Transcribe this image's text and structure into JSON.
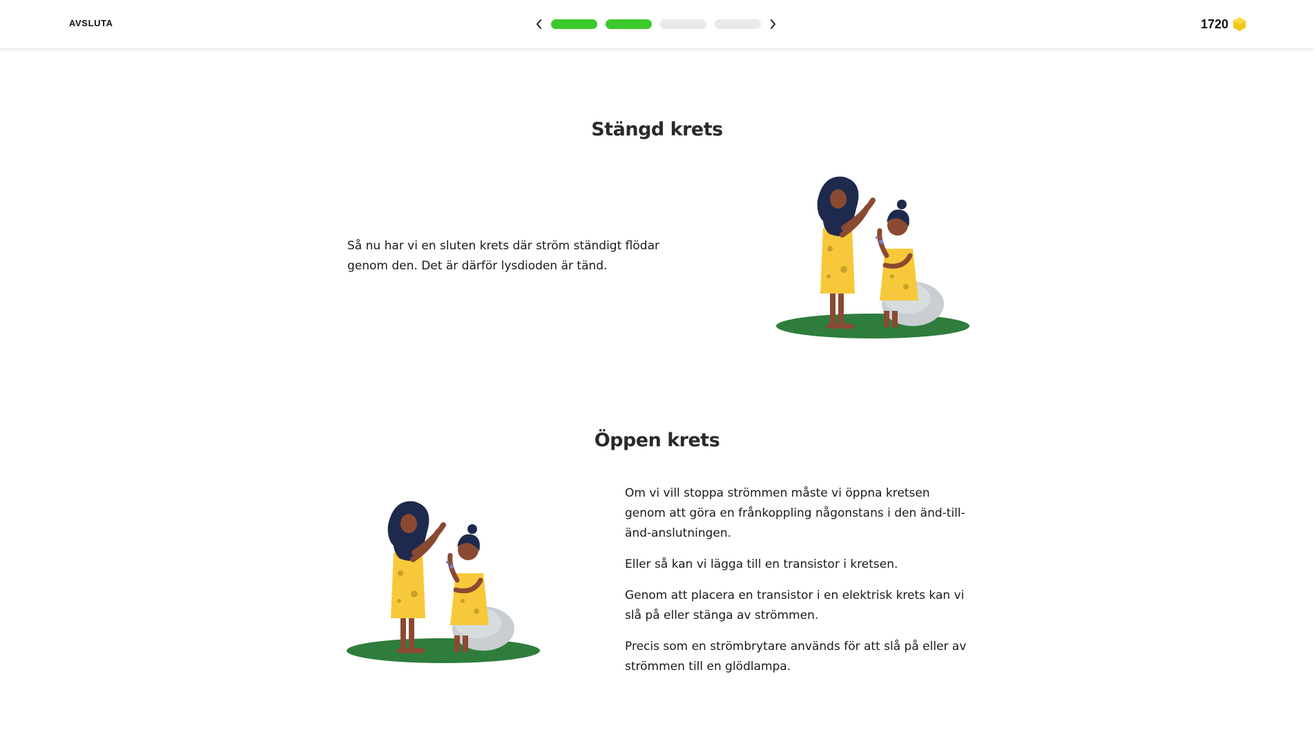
{
  "header": {
    "exit_label": "AVSLUTA",
    "progress": {
      "completed": 2,
      "total": 4
    },
    "score": "1720",
    "icons": {
      "prev": "chevron-left-icon",
      "next": "chevron-right-icon",
      "coin": "hexagon-coin-icon"
    },
    "colors": {
      "progress_done": "#3cc92c",
      "progress_todo": "#e9e9e9",
      "coin": "#f5c518"
    }
  },
  "sections": [
    {
      "title": "Stängd krets",
      "paragraphs": [
        "Så nu har vi en sluten krets där ström ständigt flödar genom den. Det är därför lysdioden är tänd."
      ],
      "illustration": "cave-people-clapping-illustration"
    },
    {
      "title": "Öppen krets",
      "paragraphs": [
        "Om vi vill stoppa strömmen måste vi öppna kretsen genom att göra en frånkoppling någonstans i den änd-till-änd-anslutningen.",
        "Eller så kan vi lägga till en transistor i kretsen.",
        "Genom att placera en transistor i en elektrisk krets kan vi slå på eller stänga av strömmen.",
        "Precis som en strömbrytare används för att slå på eller av strömmen till en glödlampa."
      ],
      "illustration": "cave-people-clapping-illustration"
    }
  ]
}
